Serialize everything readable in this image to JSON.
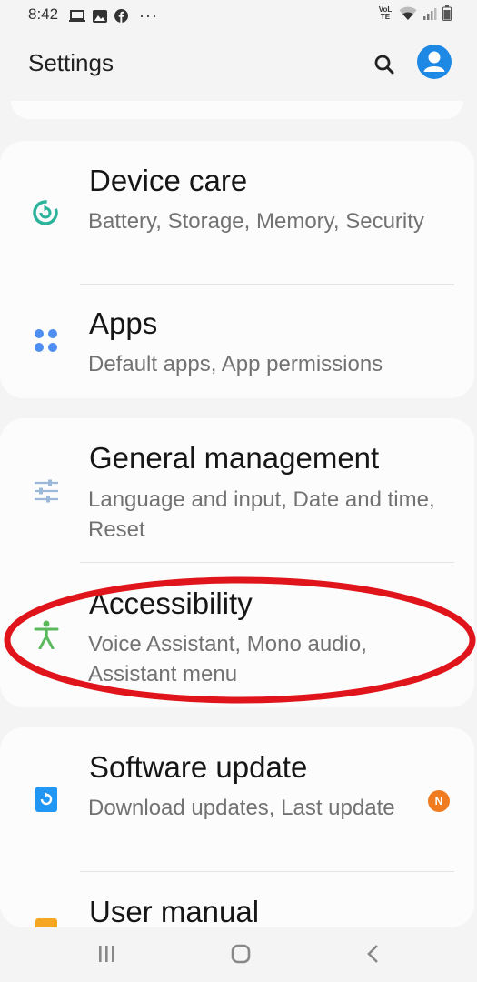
{
  "status_bar": {
    "time": "8:42",
    "network_label": "VoLTE",
    "more_indicator": "···",
    "icons": [
      "laptop-icon",
      "gallery-icon",
      "facebook-icon",
      "wifi-icon",
      "signal-icon",
      "battery-icon"
    ]
  },
  "header": {
    "title": "Settings"
  },
  "sections": {
    "device_care": {
      "title": "Device care",
      "subtitle": "Battery, Storage, Memory, Security",
      "icon": "device-care-icon",
      "icon_color": "#2bb39c"
    },
    "apps": {
      "title": "Apps",
      "subtitle": "Default apps, App permissions",
      "icon": "apps-icon",
      "icon_color": "#4d8ef0"
    },
    "general_management": {
      "title": "General management",
      "subtitle": "Language and input, Date and time, Reset",
      "icon": "sliders-icon",
      "icon_color": "#9bb8d8"
    },
    "accessibility": {
      "title": "Accessibility",
      "subtitle": "Voice Assistant, Mono audio, Assistant menu",
      "icon": "accessibility-icon",
      "icon_color": "#5cb85c"
    },
    "software_update": {
      "title": "Software update",
      "subtitle": "Download updates, Last update",
      "icon": "software-update-icon",
      "icon_color": "#2196f3",
      "badge": "N",
      "badge_color": "#f07c22"
    },
    "user_manual": {
      "title": "User manual",
      "icon": "user-manual-icon",
      "icon_color": "#f5a623"
    }
  },
  "annotation": {
    "shape": "ellipse",
    "color": "#e0141b",
    "target": "accessibility"
  },
  "nav_bar": {
    "buttons": [
      "recents-icon",
      "home-icon",
      "back-icon"
    ]
  }
}
